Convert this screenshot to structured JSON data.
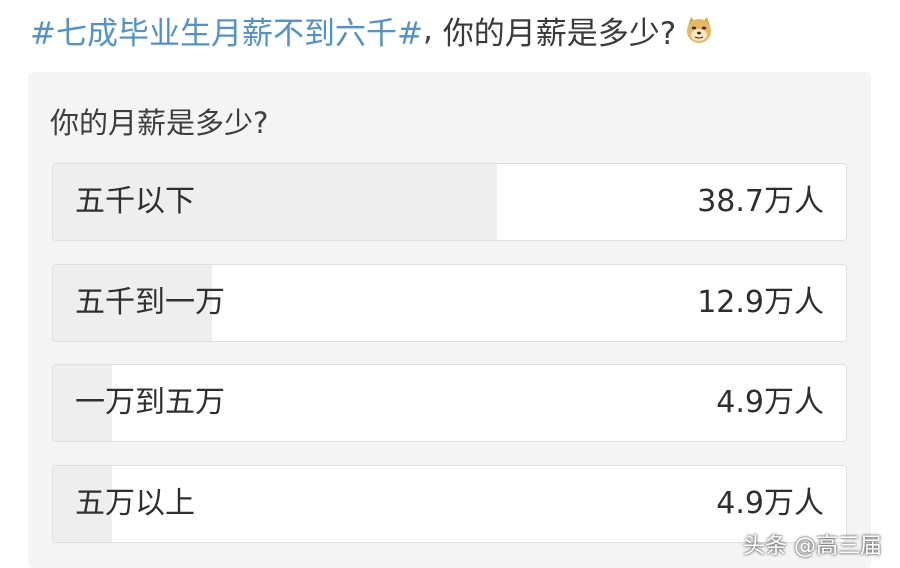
{
  "post": {
    "hashtag": "#七成毕业生月薪不到六千#",
    "comma": ",",
    "title_rest": "你的月薪是多少?",
    "emoji_icon": "doge-emoji-icon"
  },
  "poll": {
    "question": "你的月薪是多少?",
    "options": [
      {
        "label": "五千以下",
        "count": "38.7万人",
        "share": 0.56
      },
      {
        "label": "五千到一万",
        "count": "12.9万人",
        "share": 0.2
      },
      {
        "label": "一万到五万",
        "count": "4.9万人",
        "share": 0.075
      },
      {
        "label": "五万以上",
        "count": "4.9万人",
        "share": 0.075
      }
    ]
  },
  "watermark": "头条 @高三届",
  "colors": {
    "hashtag": "#4f93c8",
    "card_bg": "#f4f4f4",
    "bar_fill": "#eeeeee"
  }
}
